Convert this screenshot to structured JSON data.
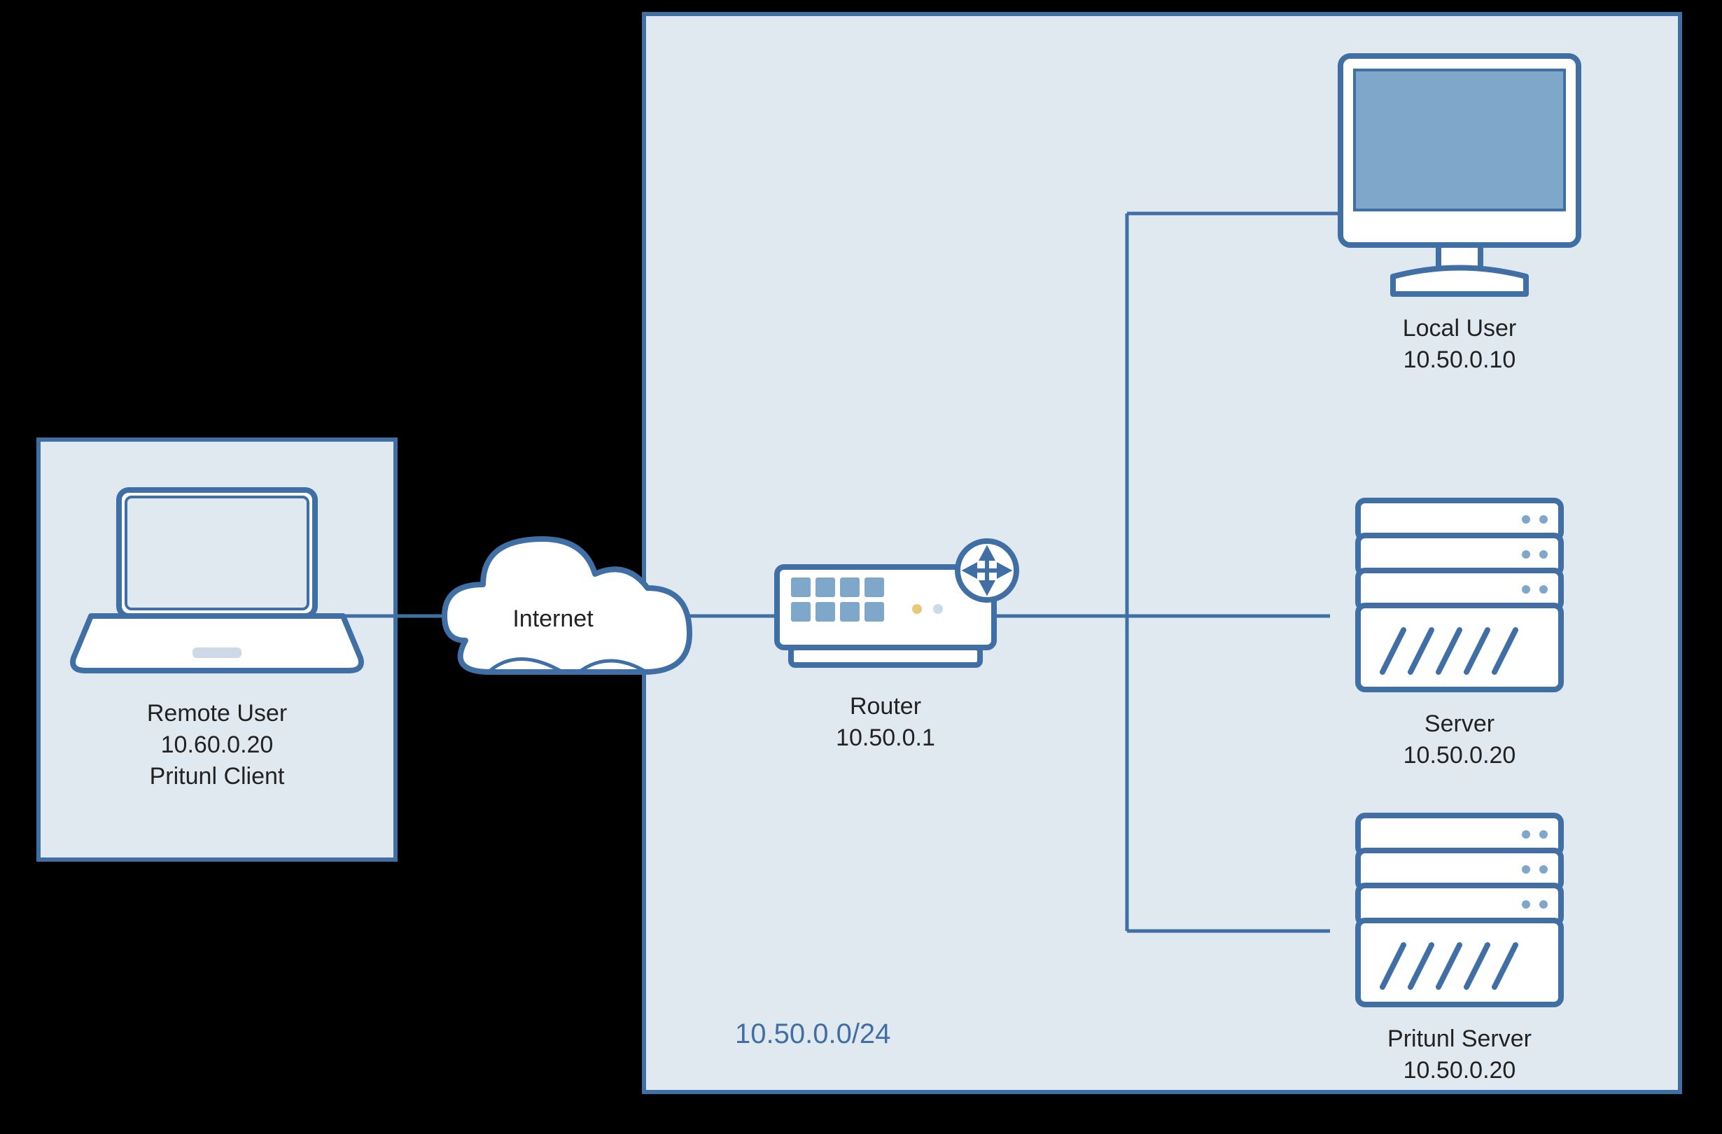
{
  "remote": {
    "title": "Remote User",
    "ip": "10.60.0.20",
    "client": "Pritunl Client"
  },
  "cloud": {
    "label": "Internet"
  },
  "lan": {
    "cidr": "10.50.0.0/24"
  },
  "router": {
    "title": "Router",
    "ip": "10.50.0.1"
  },
  "localUser": {
    "title": "Local User",
    "ip": "10.50.0.10"
  },
  "server": {
    "title": "Server",
    "ip": "10.50.0.20"
  },
  "pritunlServer": {
    "title": "Pritunl Server",
    "ip": "10.50.0.20"
  }
}
